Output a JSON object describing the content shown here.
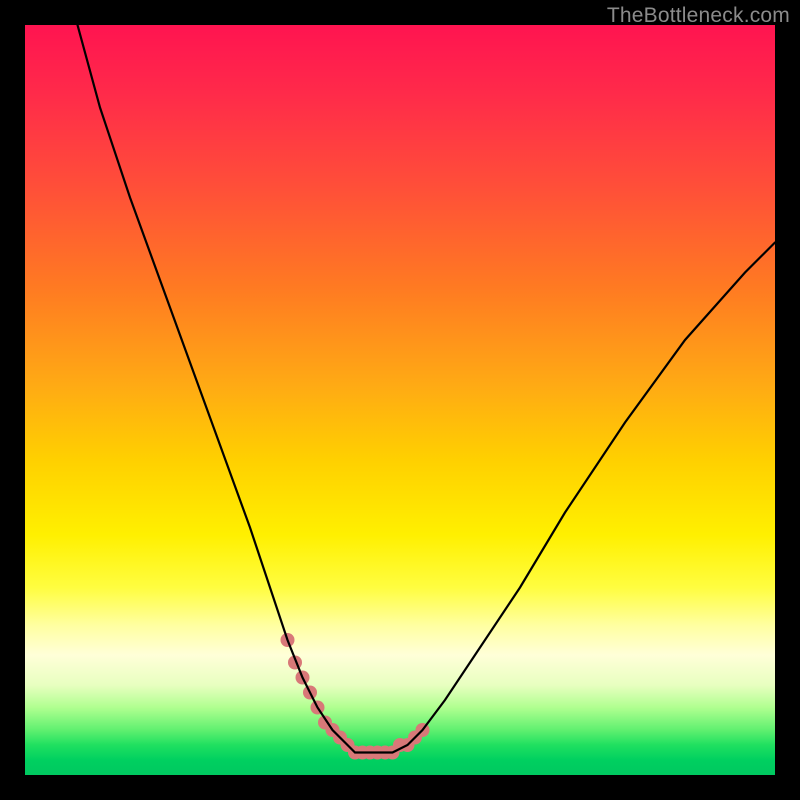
{
  "watermark": "TheBottleneck.com",
  "chart_data": {
    "type": "line",
    "title": "",
    "xlabel": "",
    "ylabel": "",
    "xlim": [
      0,
      100
    ],
    "ylim": [
      0,
      100
    ],
    "series": [
      {
        "name": "bottleneck-curve",
        "x": [
          7,
          10,
          14,
          18,
          22,
          26,
          30,
          33,
          35,
          37,
          39,
          41,
          43,
          44,
          47,
          49,
          51,
          53,
          56,
          60,
          66,
          72,
          80,
          88,
          96,
          100
        ],
        "values": [
          100,
          89,
          77,
          66,
          55,
          44,
          33,
          24,
          18,
          13,
          9,
          6,
          4,
          3,
          3,
          3,
          4,
          6,
          10,
          16,
          25,
          35,
          47,
          58,
          67,
          71
        ]
      },
      {
        "name": "highlight-dots",
        "x": [
          35,
          36,
          37,
          38,
          39,
          40,
          41,
          42,
          43,
          44,
          45,
          46,
          47,
          48,
          49,
          50,
          51,
          52,
          53
        ],
        "values": [
          18,
          15,
          13,
          11,
          9,
          7,
          6,
          5,
          4,
          3,
          3,
          3,
          3,
          3,
          3,
          4,
          4,
          5,
          6
        ]
      }
    ],
    "colors": {
      "curve": "#000000",
      "dots": "#d87878"
    }
  }
}
